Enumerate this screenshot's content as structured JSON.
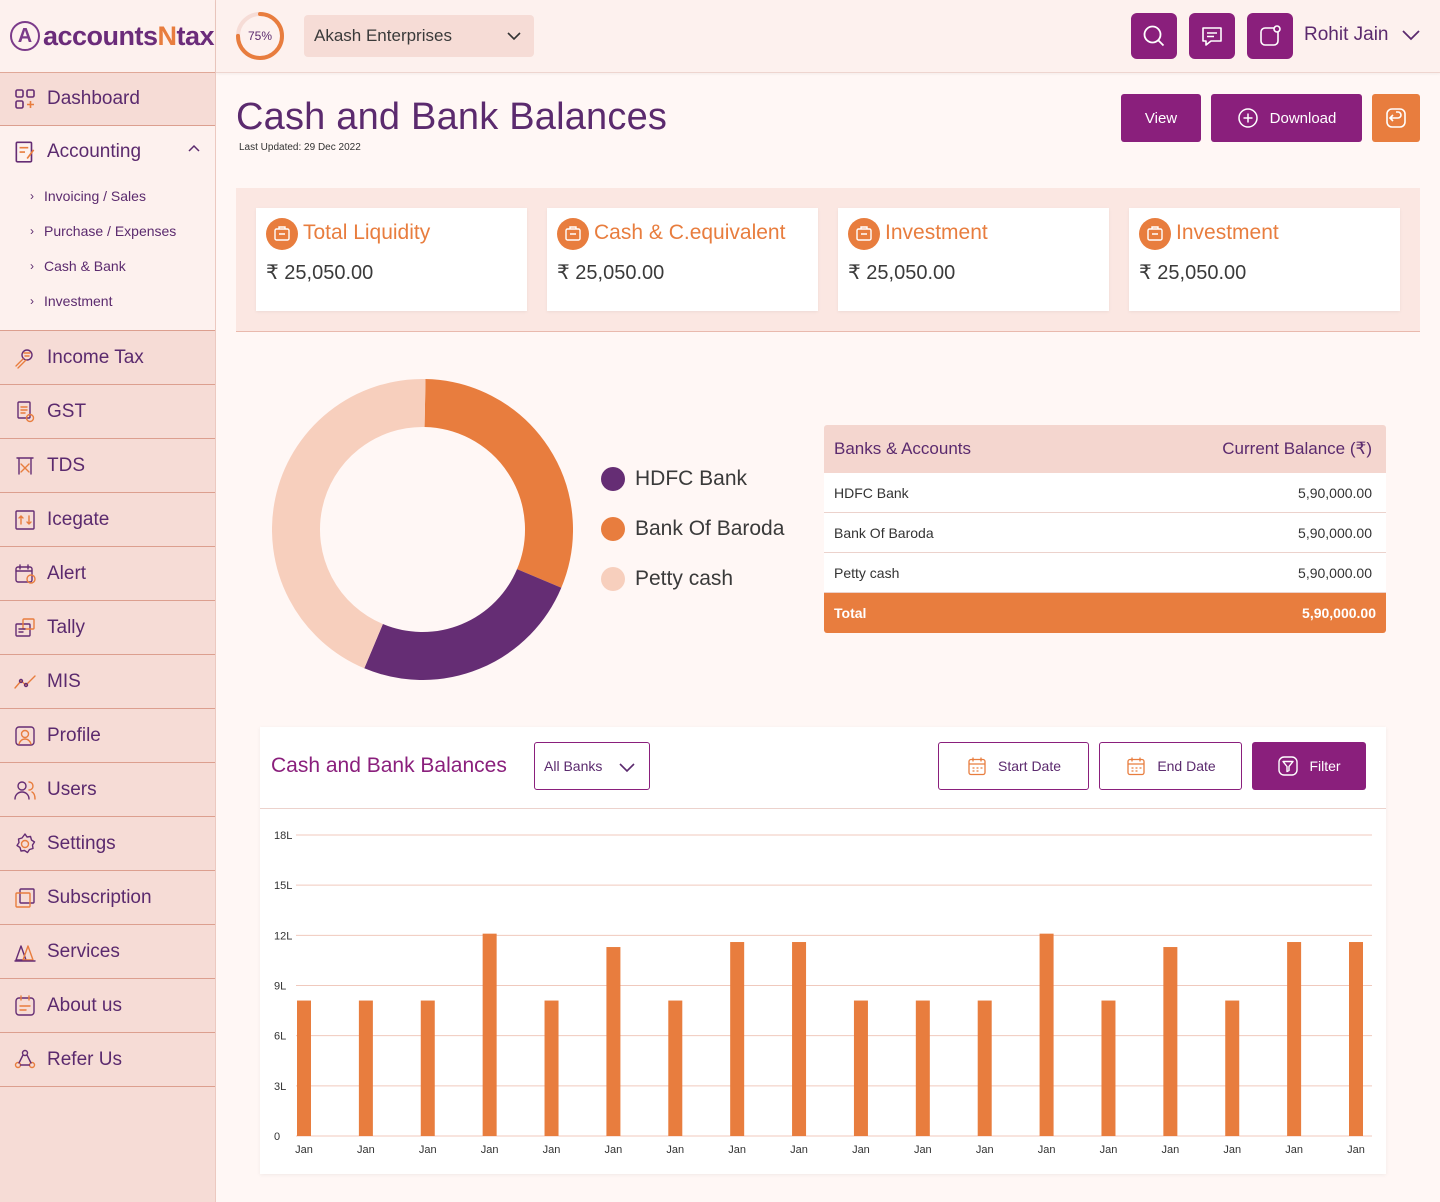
{
  "brand": {
    "logo_mark": "A",
    "logo_text_a": "accounts",
    "logo_text_n": "N",
    "logo_text_b": "tax"
  },
  "sidebar": {
    "dashboard": "Dashboard",
    "accounting": "Accounting",
    "accounting_sub": [
      "Invoicing / Sales",
      "Purchase / Expenses",
      "Cash & Bank",
      "Investment"
    ],
    "items": [
      {
        "label": "Income Tax",
        "icon": "income-tax-icon"
      },
      {
        "label": "GST",
        "icon": "gst-icon"
      },
      {
        "label": "TDS",
        "icon": "tds-icon"
      },
      {
        "label": "Icegate",
        "icon": "icegate-icon"
      },
      {
        "label": "Alert",
        "icon": "alert-icon"
      },
      {
        "label": "Tally",
        "icon": "tally-icon"
      },
      {
        "label": "MIS",
        "icon": "mis-icon"
      },
      {
        "label": "Profile",
        "icon": "profile-icon"
      },
      {
        "label": "Users",
        "icon": "users-icon"
      },
      {
        "label": "Settings",
        "icon": "settings-icon"
      },
      {
        "label": "Subscription",
        "icon": "subscription-icon"
      },
      {
        "label": "Services",
        "icon": "services-icon"
      },
      {
        "label": "About us",
        "icon": "about-icon"
      },
      {
        "label": "Refer Us",
        "icon": "refer-icon"
      }
    ]
  },
  "topbar": {
    "progress_text": "75%",
    "progress_value": 0.75,
    "company": "Akash Enterprises",
    "user_name": "Rohit Jain"
  },
  "page": {
    "title": "Cash and Bank Balances",
    "last_updated": "Last Updated: 29 Dec 2022",
    "view_label": "View",
    "download_label": "Download"
  },
  "cards": [
    {
      "title": "Total Liquidity",
      "value": "₹ 25,050.00"
    },
    {
      "title": "Cash & C.equivalent",
      "value": "₹ 25,050.00"
    },
    {
      "title": "Investment",
      "value": "₹ 25,050.00"
    },
    {
      "title": "Investment",
      "value": "₹ 25,050.00"
    }
  ],
  "donut": {
    "segments": [
      {
        "name": "HDFC Bank",
        "value": 25,
        "color": "#652d74"
      },
      {
        "name": "Bank Of Baroda",
        "value": 31,
        "color": "#e87d3e"
      },
      {
        "name": "Petty cash",
        "value": 44,
        "color": "#f7cfbd"
      }
    ]
  },
  "balances": {
    "col_bank": "Banks & Accounts",
    "col_balance": "Current Balance (₹)",
    "rows": [
      {
        "name": "HDFC Bank",
        "amount": "5,90,000.00"
      },
      {
        "name": "Bank Of Baroda",
        "amount": "5,90,000.00"
      },
      {
        "name": "Petty cash",
        "amount": "5,90,000.00"
      }
    ],
    "total_label": "Total",
    "total_amount": "5,90,000.00"
  },
  "chart_panel": {
    "title": "Cash and Bank Balances",
    "bank_select": "All Banks",
    "start_date": "Start Date",
    "end_date": "End Date",
    "filter": "Filter"
  },
  "chart_data": {
    "type": "bar",
    "categories": [
      "Jan",
      "Jan",
      "Jan",
      "Jan",
      "Jan",
      "Jan",
      "Jan",
      "Jan",
      "Jan",
      "Jan",
      "Jan",
      "Jan",
      "Jan",
      "Jan",
      "Jan",
      "Jan",
      "Jan",
      "Jan"
    ],
    "values": [
      8.1,
      8.1,
      8.1,
      12.1,
      8.1,
      11.3,
      8.1,
      11.6,
      11.6,
      8.1,
      8.1,
      8.1,
      12.1,
      8.1,
      11.3,
      8.1,
      11.6,
      11.6
    ],
    "ylim": [
      0,
      18
    ],
    "yticks": [
      "0",
      "3L",
      "6L",
      "9L",
      "12L",
      "15L",
      "18L"
    ],
    "bar_color": "#e87d3e",
    "grid": true
  }
}
